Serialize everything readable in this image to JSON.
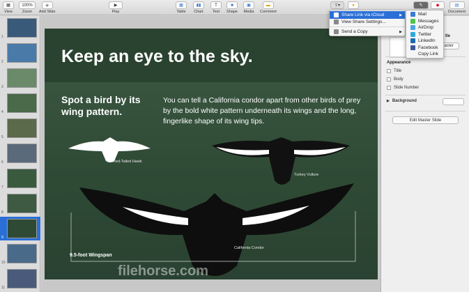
{
  "toolbar": {
    "view": "View",
    "zoom": "Zoom",
    "zoom_value": "100%",
    "add_slide": "Add Slide",
    "play": "Play",
    "table": "Table",
    "chart": "Chart",
    "text": "Text",
    "shape": "Shape",
    "media": "Media",
    "comment": "Comment",
    "document": "Document"
  },
  "navigator": {
    "slide_numbers": [
      "1",
      "2",
      "3",
      "4",
      "5",
      "6",
      "7",
      "8",
      "9",
      "10",
      "11"
    ],
    "selected_index": 8
  },
  "slide": {
    "title": "Keep an eye to the sky.",
    "subtitle": "Spot a bird by its wing pattern.",
    "body": "You can tell a California condor apart from other birds of prey by the bold white pattern underneath its wings and the long, fingerlike shape of its wing tips.",
    "label_red_tailed_hawk": "Red-Tailed Hawk",
    "label_turkey_vulture": "Turkey Vulture",
    "label_california_condor": "California Condor",
    "wingspan": "9.5-foot Wingspan"
  },
  "watermark": "filehorse.com",
  "inspector": {
    "title_partial": "tle",
    "master_partial": "aster",
    "appearance": "Appearance",
    "title_option": "Title",
    "body_option": "Body",
    "slide_number_option": "Slide Number",
    "background": "Background",
    "edit_master": "Edit Master Slide"
  },
  "share_menu": {
    "items": [
      {
        "label": "Share Link via iCloud",
        "icon": "cloud-icon"
      },
      {
        "label": "View Share Settings...",
        "icon": "settings-icon"
      },
      {
        "label": "Send a Copy",
        "icon": "send-icon"
      }
    ]
  },
  "share_submenu": {
    "items": [
      {
        "label": "Mail",
        "icon": "mail-icon",
        "color": "#3a7bd5"
      },
      {
        "label": "Messages",
        "icon": "messages-icon",
        "color": "#4fc34b"
      },
      {
        "label": "AirDrop",
        "icon": "airdrop-icon",
        "color": "#4aa3e8"
      },
      {
        "label": "Twitter",
        "icon": "twitter-icon",
        "color": "#2ea7e0"
      },
      {
        "label": "LinkedIn",
        "icon": "linkedin-icon",
        "color": "#1d6ab1"
      },
      {
        "label": "Facebook",
        "icon": "facebook-icon",
        "color": "#3b5998"
      },
      {
        "label": "Copy Link",
        "icon": "",
        "color": ""
      }
    ]
  },
  "colors": {
    "accent": "#2a6fd6",
    "slide_bg": "#2e4a35"
  }
}
